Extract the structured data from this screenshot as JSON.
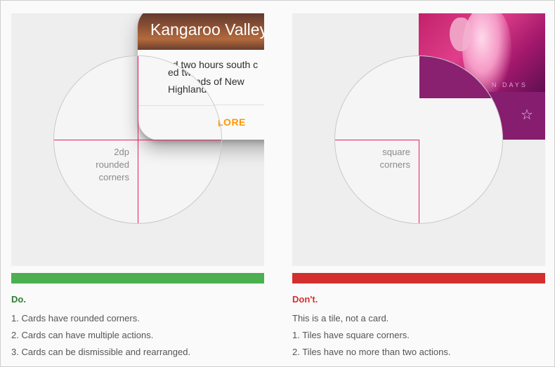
{
  "do_example": {
    "card_title": "Kangaroo Valley",
    "card_text_line1": "ed two hours south c",
    "card_text_line2": "Highlands of New",
    "card_action": "LORE",
    "callout_lines": [
      "2dp",
      "rounded",
      "corners"
    ],
    "bar_color": "#4caf50",
    "verdict": "Do.",
    "rules": [
      "1. Cards have rounded corners.",
      "2. Cards can have multiple actions.",
      "3. Cards can be dismissible and rearranged."
    ]
  },
  "dont_example": {
    "tile_caption": "N DAYS",
    "icon": "star-outline-icon",
    "callout_lines": [
      "square",
      "corners"
    ],
    "bar_color": "#d32f2f",
    "verdict": "Don't.",
    "rules": [
      "This is a tile, not a card.",
      "1. Tiles have square corners.",
      "2. Tiles have no more than two actions."
    ]
  },
  "colors": {
    "guide_line": "#e91e63",
    "card_action": "#ff9800",
    "tile": "#861d6e"
  }
}
